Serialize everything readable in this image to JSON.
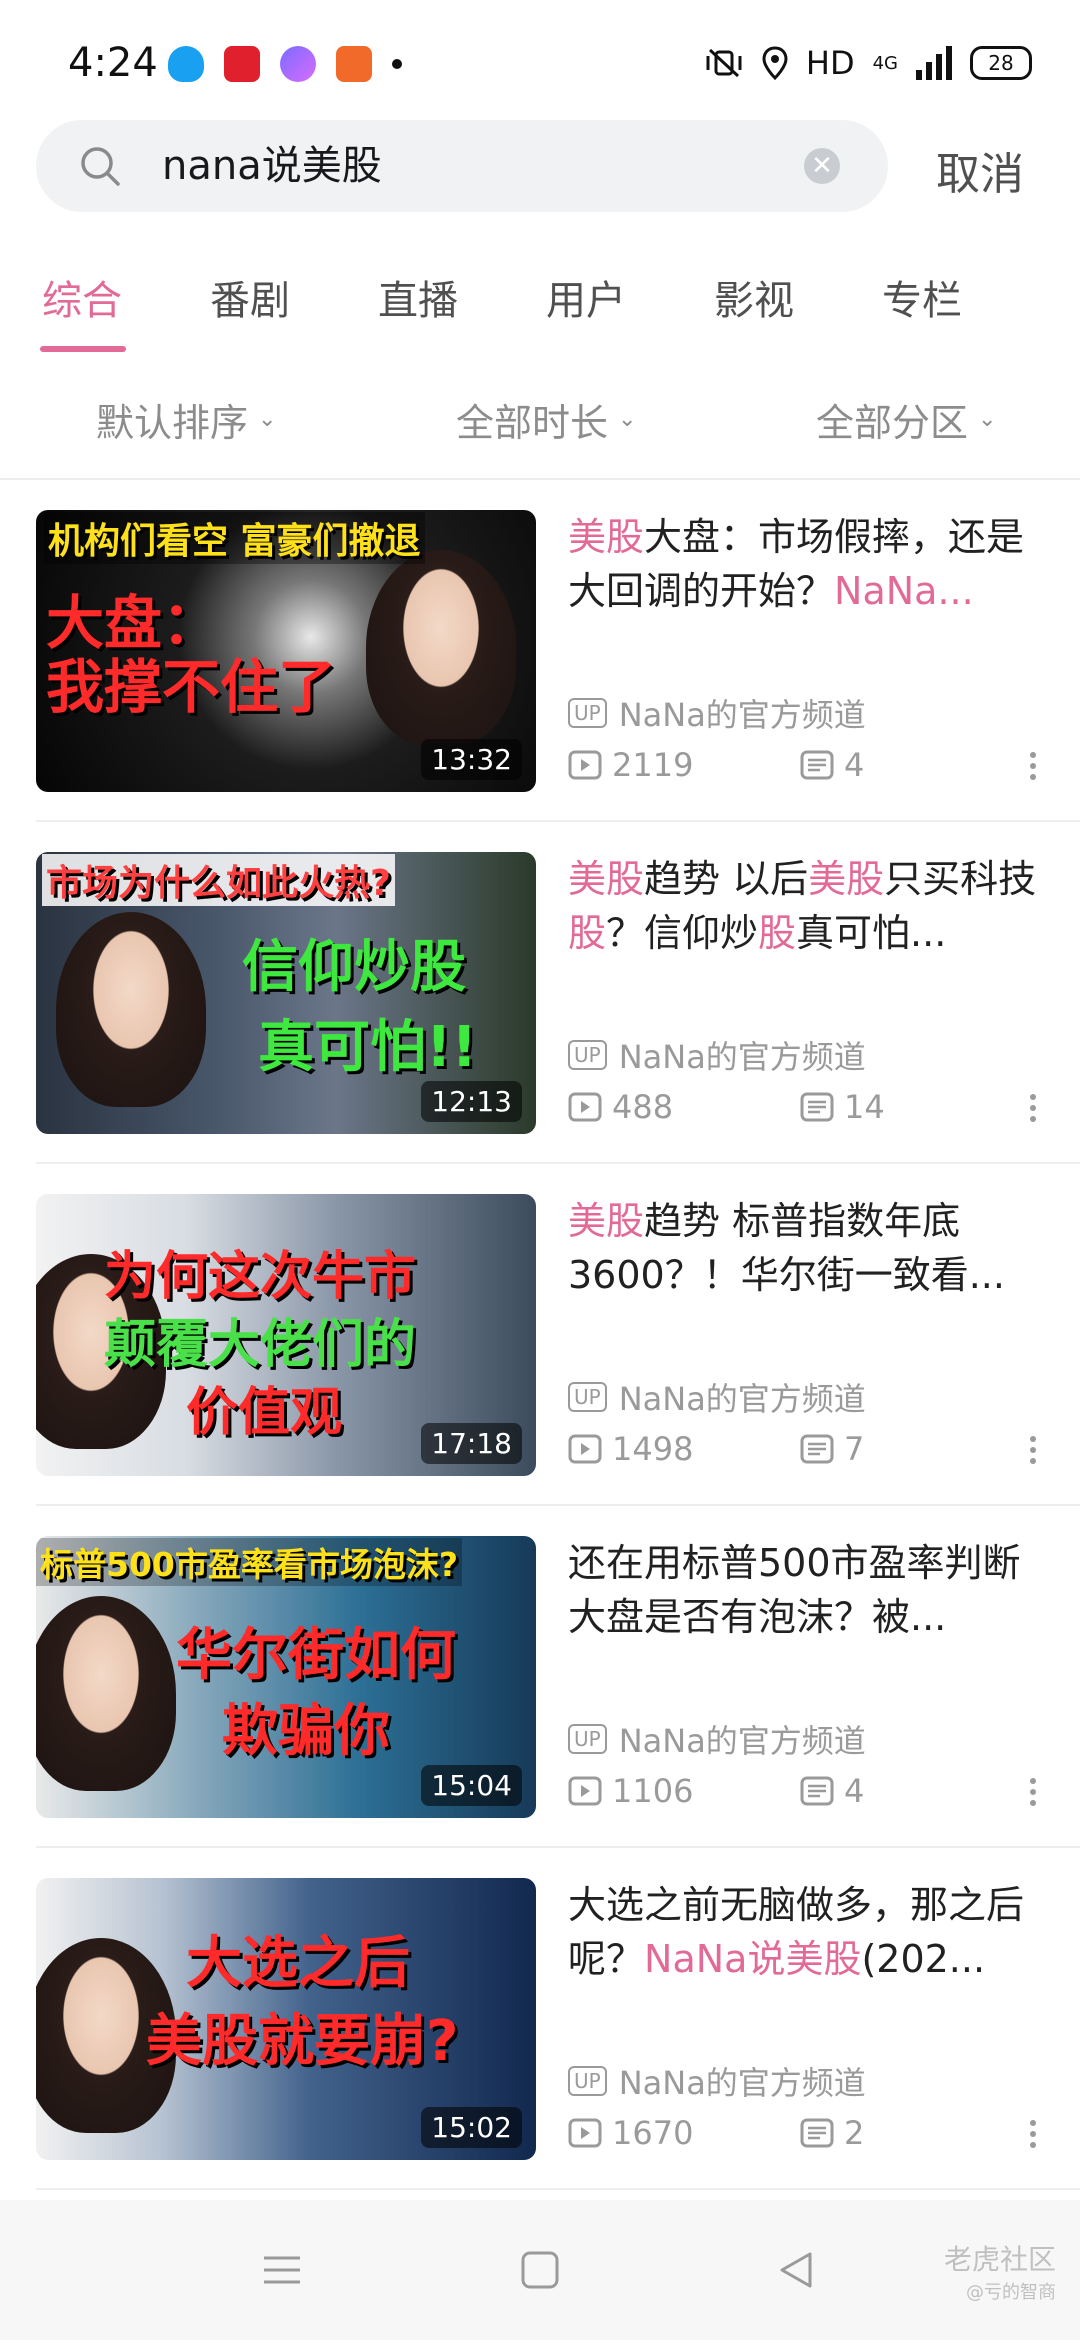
{
  "status_bar": {
    "time": "4:24",
    "network": "HD",
    "net_type": "4G",
    "battery": "28"
  },
  "search": {
    "query": "nana说美股",
    "cancel": "取消"
  },
  "tabs": [
    "综合",
    "番剧",
    "直播",
    "用户",
    "影视",
    "专栏"
  ],
  "active_tab": "综合",
  "filters": [
    "默认排序",
    "全部时长",
    "全部分区"
  ],
  "results": [
    {
      "title_parts": [
        {
          "t": "美股",
          "hl": true
        },
        {
          "t": "大盘：市场假摔，还是大回调的开始？",
          "hl": false
        },
        {
          "t": "NaNa...",
          "hl": true
        }
      ],
      "uploader": "NaNa的官方频道",
      "views": "2119",
      "danmaku": "4",
      "duration": "13:32",
      "thumb_text": [
        "机构们看空 富豪们撤退",
        "大盘：",
        "我撑不住了"
      ]
    },
    {
      "title_parts": [
        {
          "t": "美股",
          "hl": true
        },
        {
          "t": "趋势 以后",
          "hl": false
        },
        {
          "t": "美股",
          "hl": true
        },
        {
          "t": "只买科技",
          "hl": false
        },
        {
          "t": "股",
          "hl": true
        },
        {
          "t": "？信仰炒",
          "hl": false
        },
        {
          "t": "股",
          "hl": true
        },
        {
          "t": "真可怕...",
          "hl": false
        }
      ],
      "uploader": "NaNa的官方频道",
      "views": "488",
      "danmaku": "14",
      "duration": "12:13",
      "thumb_text": [
        "市场为什么如此火热?",
        "信仰炒股",
        "真可怕!!"
      ]
    },
    {
      "title_parts": [
        {
          "t": "美股",
          "hl": true
        },
        {
          "t": "趋势 标普指数年底3600？！华尔街一致看...",
          "hl": false
        }
      ],
      "uploader": "NaNa的官方频道",
      "views": "1498",
      "danmaku": "7",
      "duration": "17:18",
      "thumb_text": [
        "为何这次牛市",
        "颠覆大佬们的",
        "价值观"
      ]
    },
    {
      "title_parts": [
        {
          "t": "还在用标普500市盈率判断大盘是否有泡沫？被...",
          "hl": false
        }
      ],
      "uploader": "NaNa的官方频道",
      "views": "1106",
      "danmaku": "4",
      "duration": "15:04",
      "thumb_text": [
        "标普500市盈率看市场泡沫?",
        "华尔街如何",
        "欺骗你"
      ]
    },
    {
      "title_parts": [
        {
          "t": "大选之前无脑做多，那之后呢？",
          "hl": false
        },
        {
          "t": "NaNa说美股",
          "hl": true
        },
        {
          "t": "(202...",
          "hl": false
        }
      ],
      "uploader": "NaNa的官方频道",
      "views": "1670",
      "danmaku": "2",
      "duration": "15:02",
      "thumb_text": [
        "大选之后",
        "美股就要崩?"
      ]
    }
  ],
  "up_tag": "UP",
  "watermark": {
    "main": "老虎社区",
    "sub": "@亏的智商"
  },
  "colors": {
    "accent": "#e26a97",
    "meta": "#9a9a9a"
  }
}
